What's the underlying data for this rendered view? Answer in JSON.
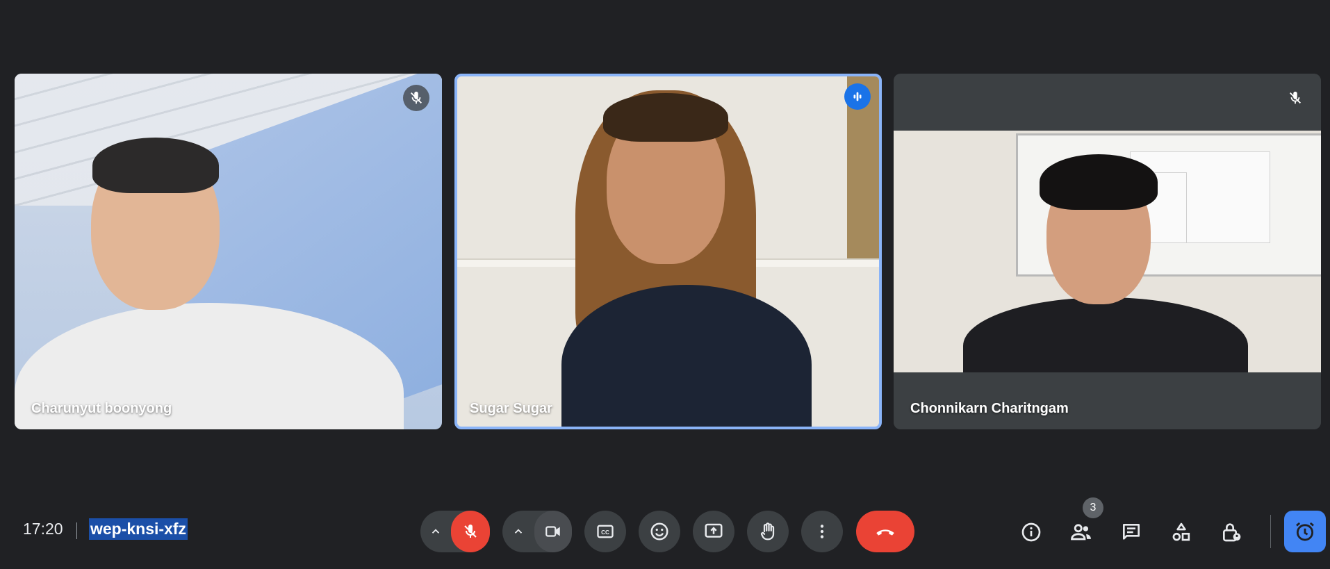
{
  "participants": [
    {
      "name": "Charunyut boonyong",
      "muted": true,
      "speaking": false
    },
    {
      "name": "Sugar Sugar",
      "muted": false,
      "speaking": true
    },
    {
      "name": "Chonnikarn Charitngam",
      "muted": true,
      "speaking": false
    }
  ],
  "meeting": {
    "time": "17:20",
    "code": "wep-knsi-xfz",
    "participant_count": "3"
  },
  "icons": {
    "mic_muted": "mic-off-icon",
    "speaking": "audio-level-icon",
    "camera": "videocam-icon",
    "captions": "closed-captions-icon",
    "reactions": "emoji-icon",
    "present": "present-screen-icon",
    "hand": "raise-hand-icon",
    "more": "more-vert-icon",
    "leave": "call-end-icon",
    "info": "info-icon",
    "people": "people-icon",
    "chat": "chat-icon",
    "activities": "activities-icon",
    "host_controls": "lock-person-icon",
    "timer": "timer-icon"
  },
  "colors": {
    "background": "#202124",
    "control": "#3c4043",
    "danger": "#ea4335",
    "active_speaker": "#8ab4f8",
    "accent": "#4285f4",
    "code_highlight": "#1b4fa8"
  }
}
